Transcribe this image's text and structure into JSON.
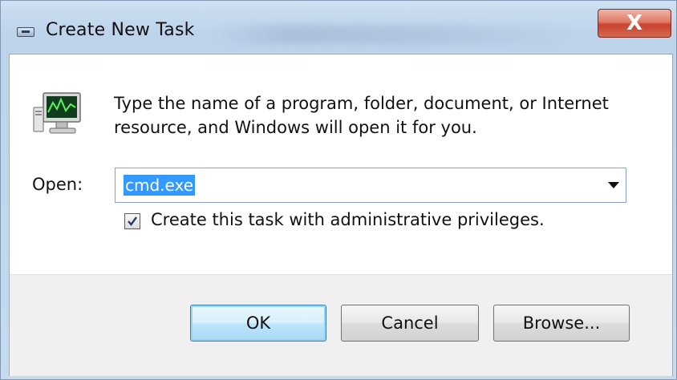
{
  "window": {
    "title": "Create New Task",
    "close_symbol": "X"
  },
  "icons": {
    "title_icon": "run-dialog-icon",
    "app_icon": "computer-monitor-icon",
    "close_icon": "close-icon",
    "dropdown_icon": "chevron-down-icon",
    "check_icon": "checkmark-icon"
  },
  "dialog": {
    "instruction_line1": "Type the name of a program, folder, document, or Internet",
    "instruction_line2": "resource, and Windows will open it for you.",
    "open_label": "Open:",
    "open_value": "cmd.exe",
    "admin_checkbox_label": "Create this task with administrative privileges.",
    "admin_checked": true
  },
  "buttons": {
    "ok": "OK",
    "cancel": "Cancel",
    "browse": "Browse..."
  },
  "colors": {
    "selection": "#3399ff",
    "close_button": "#c9422e",
    "frame": "#c7daee"
  }
}
